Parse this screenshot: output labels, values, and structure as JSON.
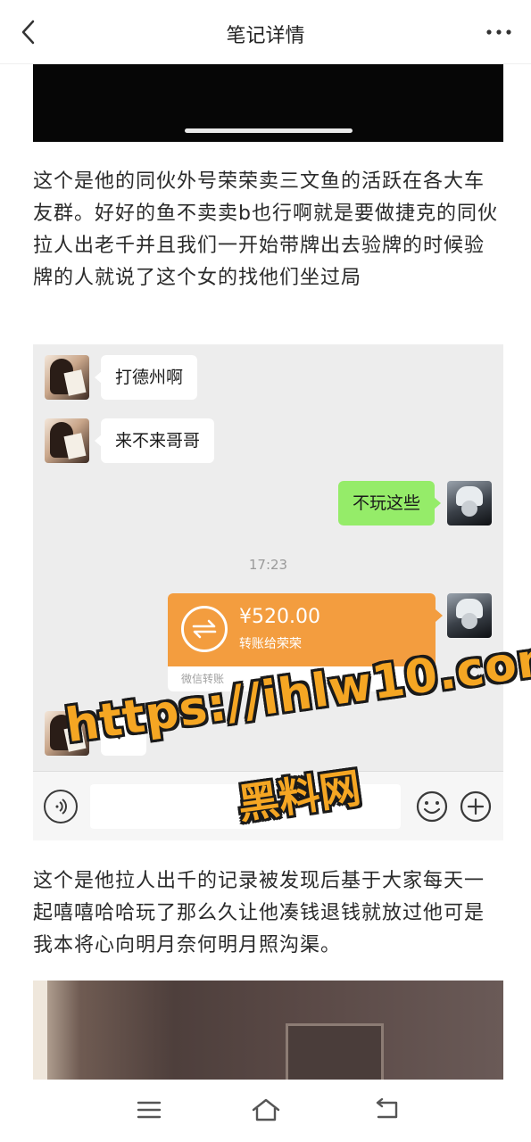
{
  "header": {
    "title": "笔记详情",
    "back_icon": "chevron-left-icon",
    "more_icon": "more-horizontal-icon"
  },
  "post": {
    "paragraph1": "这个是他的同伙外号荣荣卖三文鱼的活跃在各大车友群。好好的鱼不卖卖b也行啊就是要做捷克的同伙拉人出老千并且我们一开始带牌出去验牌的时候验牌的人就说了这个女的找他们坐过局",
    "paragraph2": "这个是他拉人出千的记录被发现后基于大家每天一起嘻嘻哈哈玩了那么久让他凑钱退钱就放过他可是我本将心向明月奈何明月照沟渠。"
  },
  "chat": {
    "messages": [
      {
        "side": "left",
        "text": "打德州啊"
      },
      {
        "side": "left",
        "text": "来不来哥哥"
      },
      {
        "side": "right",
        "text": "不玩这些"
      }
    ],
    "timestamp": "17:23",
    "transfer": {
      "amount": "¥520.00",
      "description": "转账给荣荣",
      "footer": "微信转账",
      "color": "#f39d3f"
    },
    "reply": "？"
  },
  "watermark": {
    "url": "https://ihlw10.com",
    "name": "黑料网",
    "color": "#f5a623"
  },
  "colors": {
    "chat_background": "#ededed",
    "outgoing_bubble": "#95ec69",
    "incoming_bubble": "#ffffff"
  },
  "bottom_nav": {
    "menu_icon": "menu-icon",
    "home_icon": "home-icon",
    "back_icon": "back-icon"
  }
}
